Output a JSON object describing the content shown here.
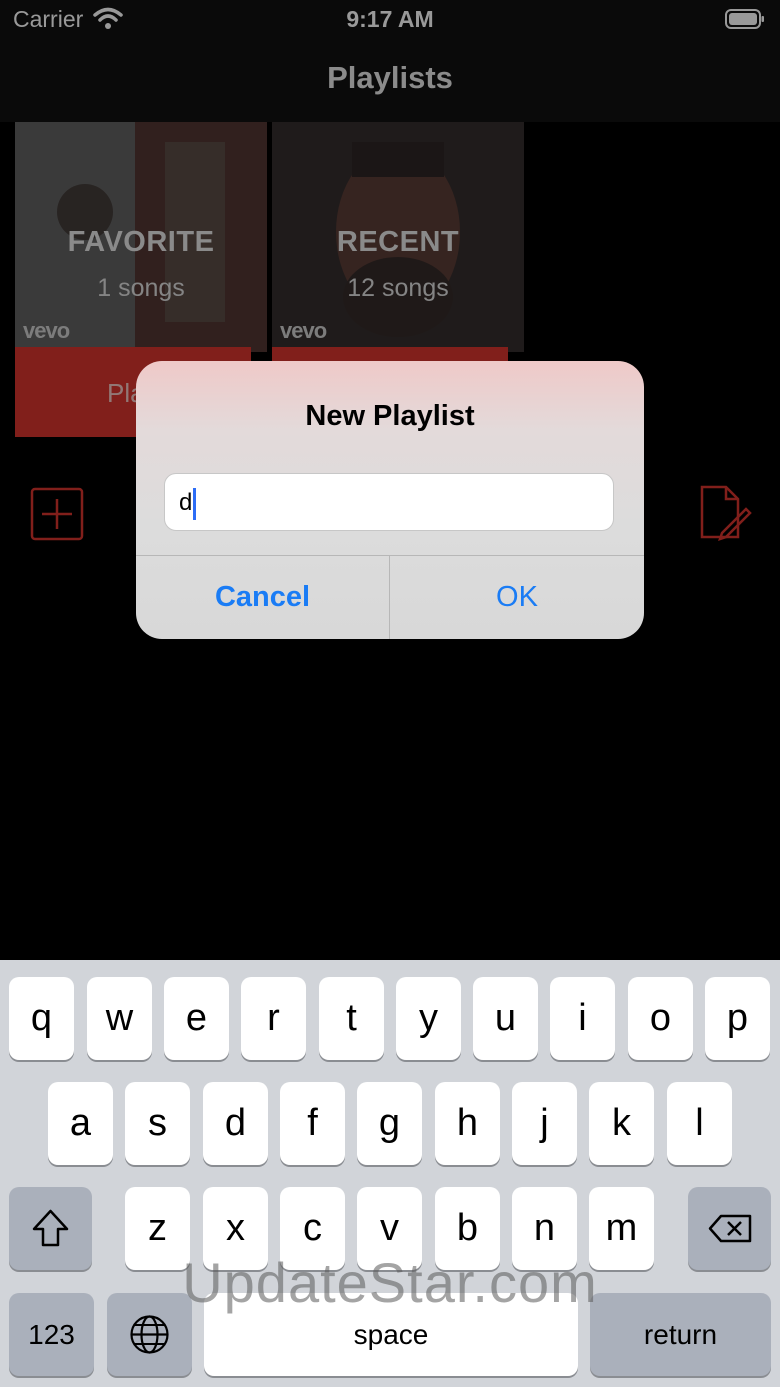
{
  "status_bar": {
    "carrier": "Carrier",
    "time": "9:17 AM"
  },
  "nav": {
    "title": "Playlists"
  },
  "playlists": [
    {
      "title": "FAVORITE",
      "count": "1 songs",
      "badge": "vevo"
    },
    {
      "title": "RECENT",
      "count": "12 songs",
      "badge": "vevo"
    }
  ],
  "play_button": {
    "label": "Pla"
  },
  "dialog": {
    "title": "New Playlist",
    "input_value": "d",
    "cancel_label": "Cancel",
    "ok_label": "OK"
  },
  "keyboard": {
    "row1": [
      "q",
      "w",
      "e",
      "r",
      "t",
      "y",
      "u",
      "i",
      "o",
      "p"
    ],
    "row2": [
      "a",
      "s",
      "d",
      "f",
      "g",
      "h",
      "j",
      "k",
      "l"
    ],
    "row3": [
      "z",
      "x",
      "c",
      "v",
      "b",
      "n",
      "m"
    ],
    "numbers_label": "123",
    "space_label": "space",
    "return_label": "return"
  },
  "watermark": "UpdateStar.com",
  "colors": {
    "accent_red": "#d8352d",
    "ios_blue": "#1a7cf5",
    "keyboard_bg": "#d1d4d9"
  }
}
